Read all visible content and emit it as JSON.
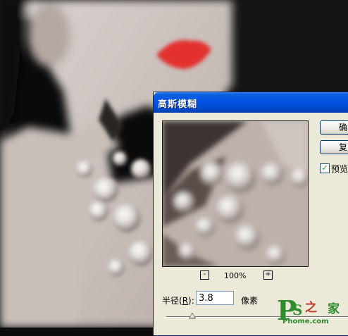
{
  "dialog": {
    "title": "高斯模糊",
    "zoom": {
      "minus": "-",
      "level": "100%",
      "plus": "+"
    },
    "radius": {
      "label_prefix": "半径(",
      "label_hotkey": "R",
      "label_suffix": "):",
      "value": "3.8",
      "unit": "像素"
    },
    "buttons": {
      "ok": "确",
      "reset": "复"
    },
    "preview": {
      "label": "预览",
      "checked": true
    }
  },
  "watermark": {
    "p": "P",
    "s": "S",
    "zhi": "之",
    "jia": "家",
    "domain": "Phome.com"
  }
}
